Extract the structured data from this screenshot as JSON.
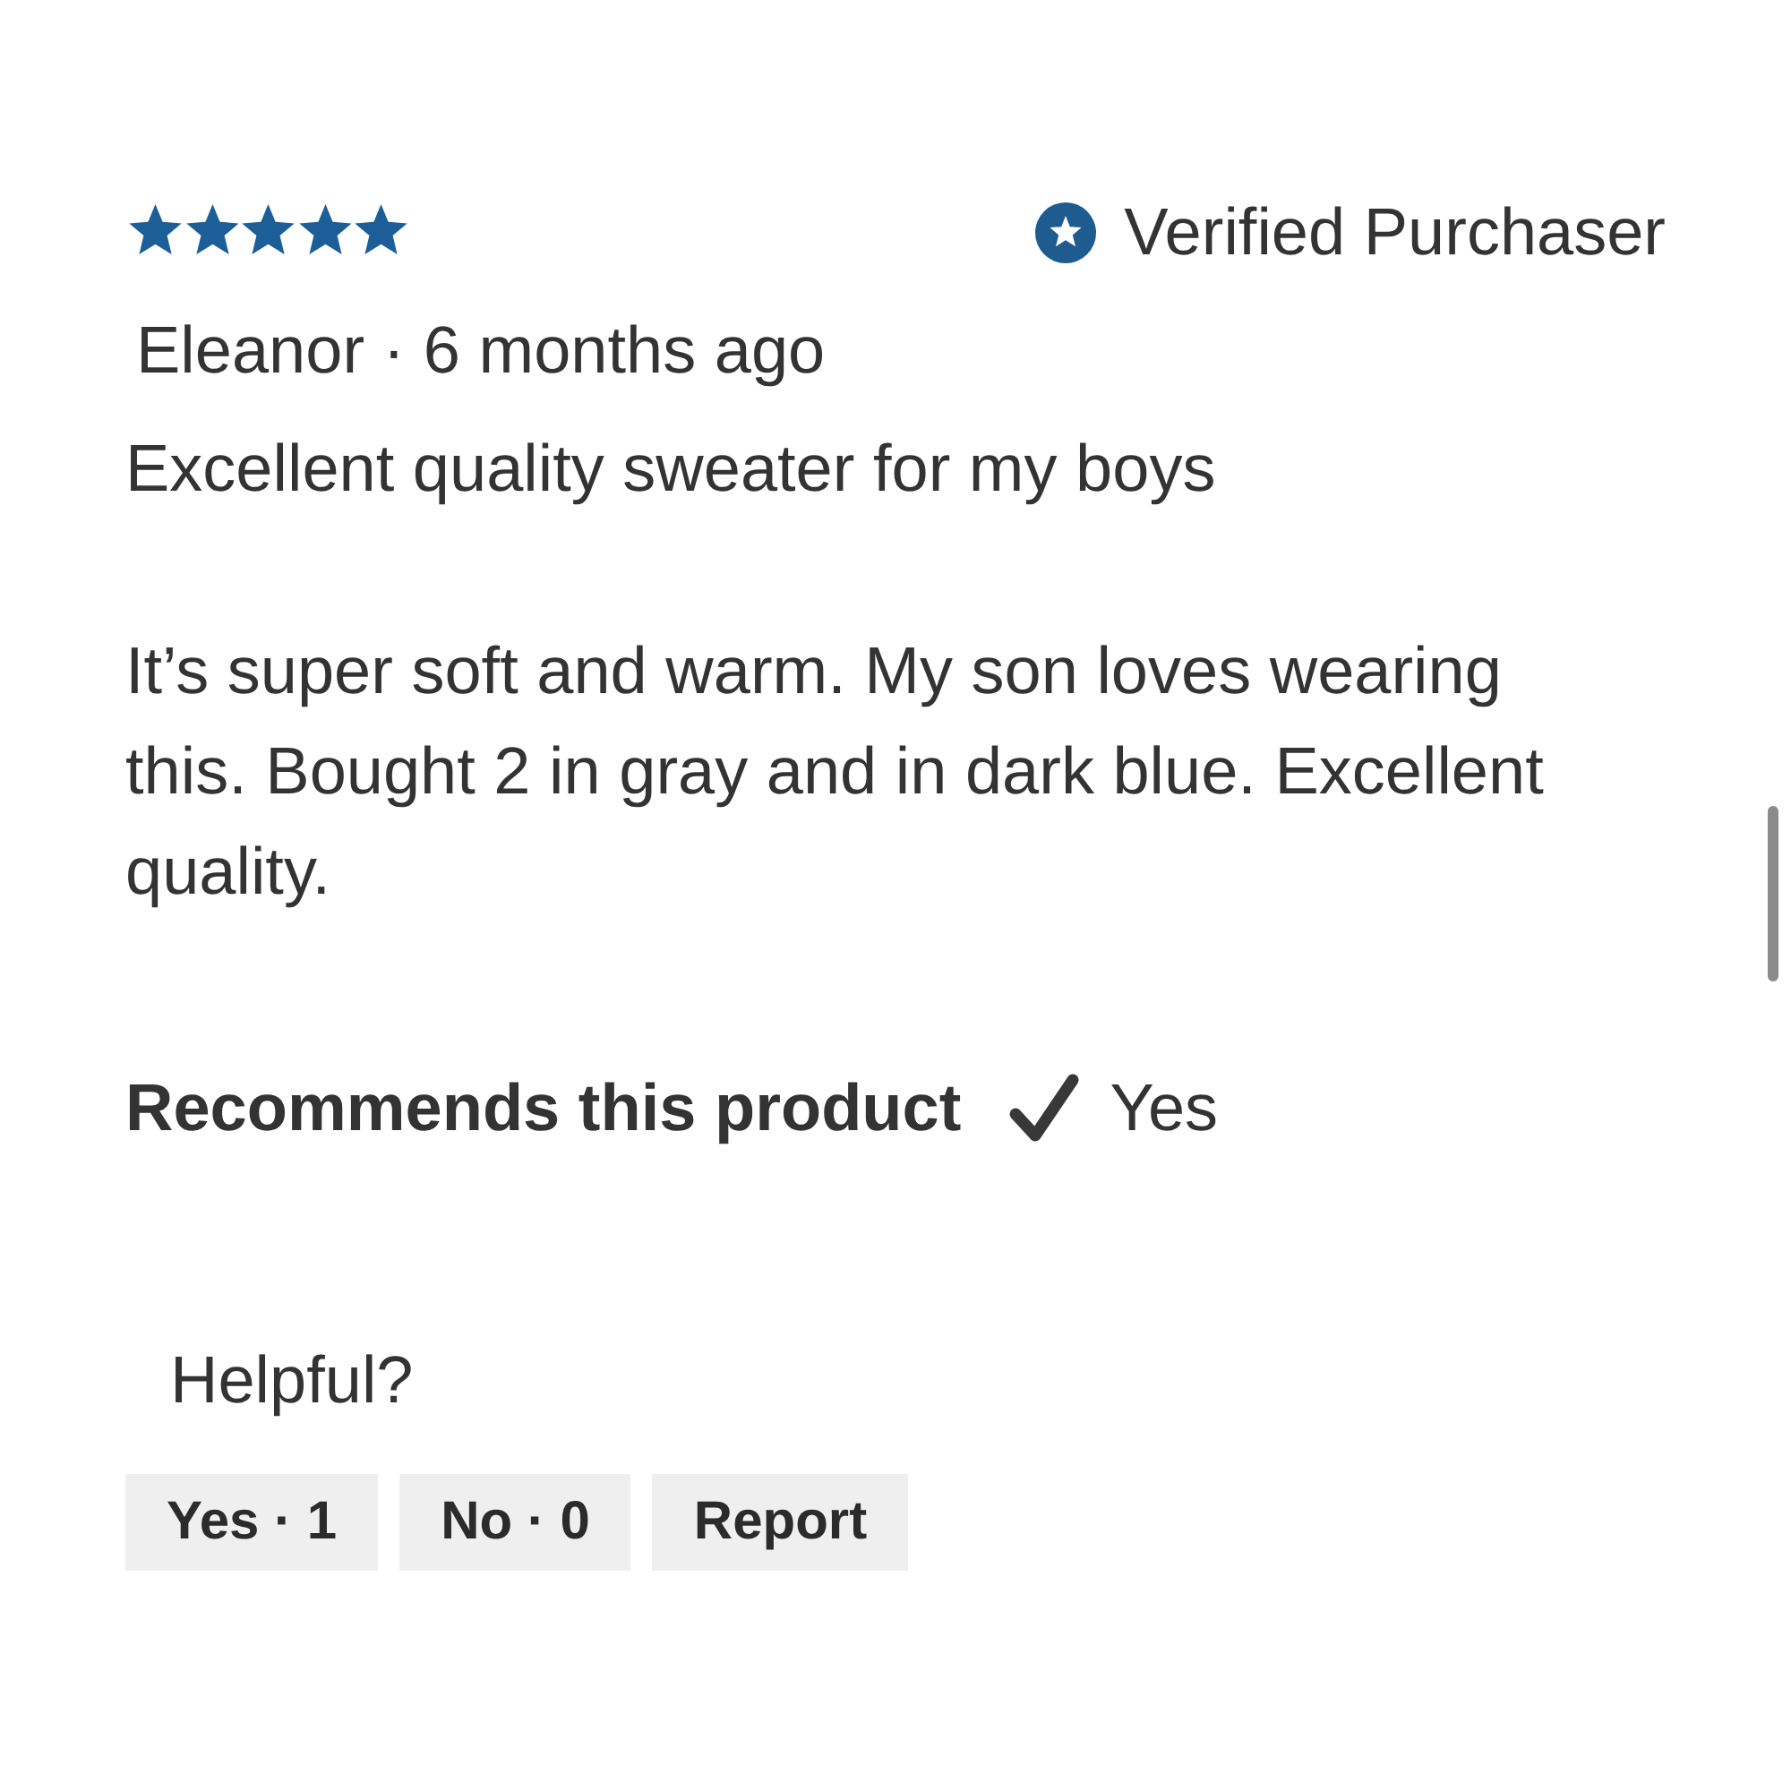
{
  "review": {
    "stars": 5,
    "verified_badge": {
      "label": "Verified Purchaser"
    },
    "byline": "Eleanor · 6 months ago",
    "title": "Excellent quality sweater for my boys",
    "body": "It’s super soft and warm. My son loves wearing this. Bought 2 in gray and in dark blue. Excellent quality.",
    "recommendation": {
      "label": "Recommends this product",
      "checked": true,
      "answer": "Yes"
    }
  },
  "helpful": {
    "label": "Helpful?",
    "buttons": [
      {
        "label": "Yes · 1"
      },
      {
        "label": "No · 0"
      },
      {
        "label": "Report"
      }
    ]
  }
}
